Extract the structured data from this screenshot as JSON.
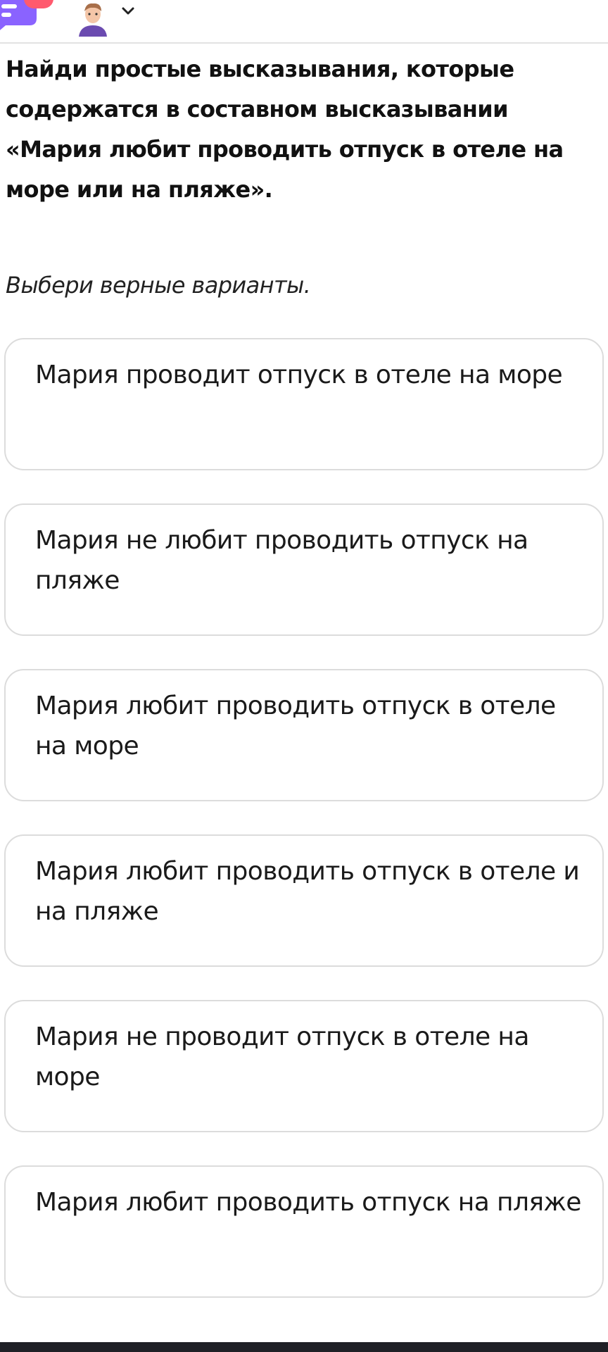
{
  "header": {
    "chat_icon": "chat-icon",
    "avatar_icon": "avatar-icon",
    "chevron_icon": "chevron-down-icon",
    "accent_color": "#8a63ff",
    "badge_color": "#ff5a6e"
  },
  "task": {
    "question": "Найди простые высказывания, которые содержатся в составном высказывании «Мария любит проводить отпуск в отеле на море или на пляже».",
    "instruction": "Выбери верные варианты."
  },
  "options": [
    {
      "label": "Мария проводит отпуск в отеле на море"
    },
    {
      "label": "Мария не любит проводить отпуск на пляже"
    },
    {
      "label": "Мария любит проводить отпуск в отеле на море"
    },
    {
      "label": "Мария любит проводить отпуск в отеле и на пляже"
    },
    {
      "label": "Мария не проводит отпуск в отеле на море"
    },
    {
      "label": "Мария любит проводить отпуск на пляже"
    }
  ]
}
